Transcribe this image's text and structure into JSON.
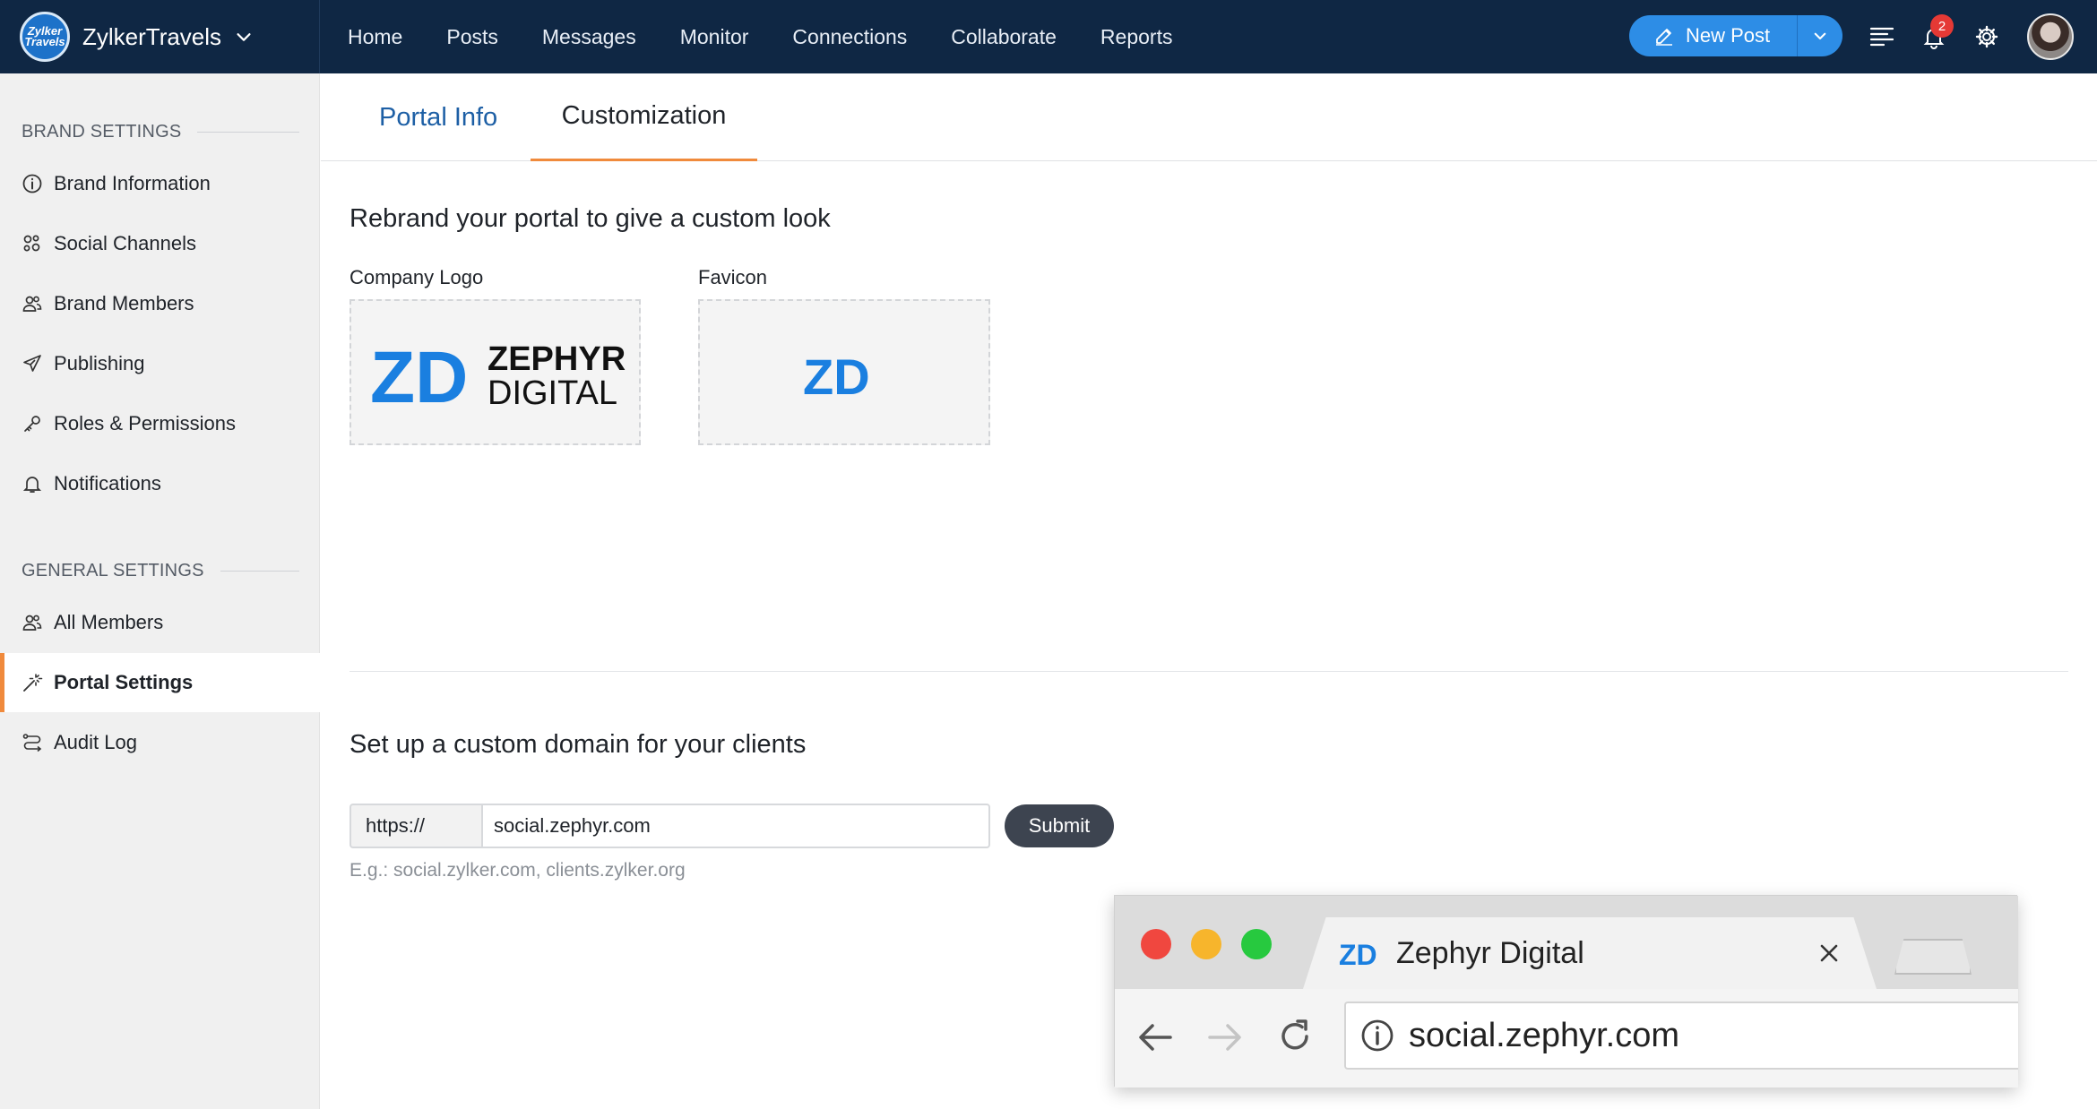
{
  "app": {
    "brand_name": "ZylkerTravels",
    "brand_logo_text": "Zylker Travels"
  },
  "nav": {
    "items": [
      {
        "label": "Home"
      },
      {
        "label": "Posts"
      },
      {
        "label": "Messages"
      },
      {
        "label": "Monitor"
      },
      {
        "label": "Connections"
      },
      {
        "label": "Collaborate"
      },
      {
        "label": "Reports"
      }
    ],
    "new_post_label": "New Post",
    "notification_count": "2"
  },
  "sidebar": {
    "brand_settings_heading": "BRAND SETTINGS",
    "brand_items": [
      {
        "label": "Brand Information",
        "icon": "info-icon"
      },
      {
        "label": "Social Channels",
        "icon": "social-channels-icon"
      },
      {
        "label": "Brand Members",
        "icon": "members-icon"
      },
      {
        "label": "Publishing",
        "icon": "send-icon"
      },
      {
        "label": "Roles & Permissions",
        "icon": "key-icon"
      },
      {
        "label": "Notifications",
        "icon": "bell-icon"
      }
    ],
    "general_settings_heading": "GENERAL SETTINGS",
    "general_items": [
      {
        "label": "All Members",
        "icon": "members-icon"
      },
      {
        "label": "Portal Settings",
        "icon": "magic-wand-icon",
        "active": true
      },
      {
        "label": "Audit Log",
        "icon": "audit-log-icon"
      }
    ]
  },
  "tabs": {
    "portal_info": "Portal Info",
    "customization": "Customization",
    "active": "Customization"
  },
  "rebrand": {
    "title": "Rebrand your portal to give a custom look",
    "company_logo_label": "Company Logo",
    "favicon_label": "Favicon",
    "logo_mark": "ZD",
    "logo_word_1": "ZEPHYR",
    "logo_word_2": "DIGITAL"
  },
  "domain": {
    "title": "Set up a custom domain for your clients",
    "prefix": "https://",
    "value": "social.zephyr.com",
    "submit_label": "Submit",
    "hint": "E.g.: social.zylker.com, clients.zylker.org"
  },
  "browser_preview": {
    "tab_title": "Zephyr Digital",
    "address": "social.zephyr.com"
  },
  "colors": {
    "topbar": "#0f2744",
    "accent_orange": "#f08a3c",
    "primary_blue": "#2d8de6",
    "logo_blue": "#1a7fe0",
    "tab_blue": "#1d5fa5"
  }
}
